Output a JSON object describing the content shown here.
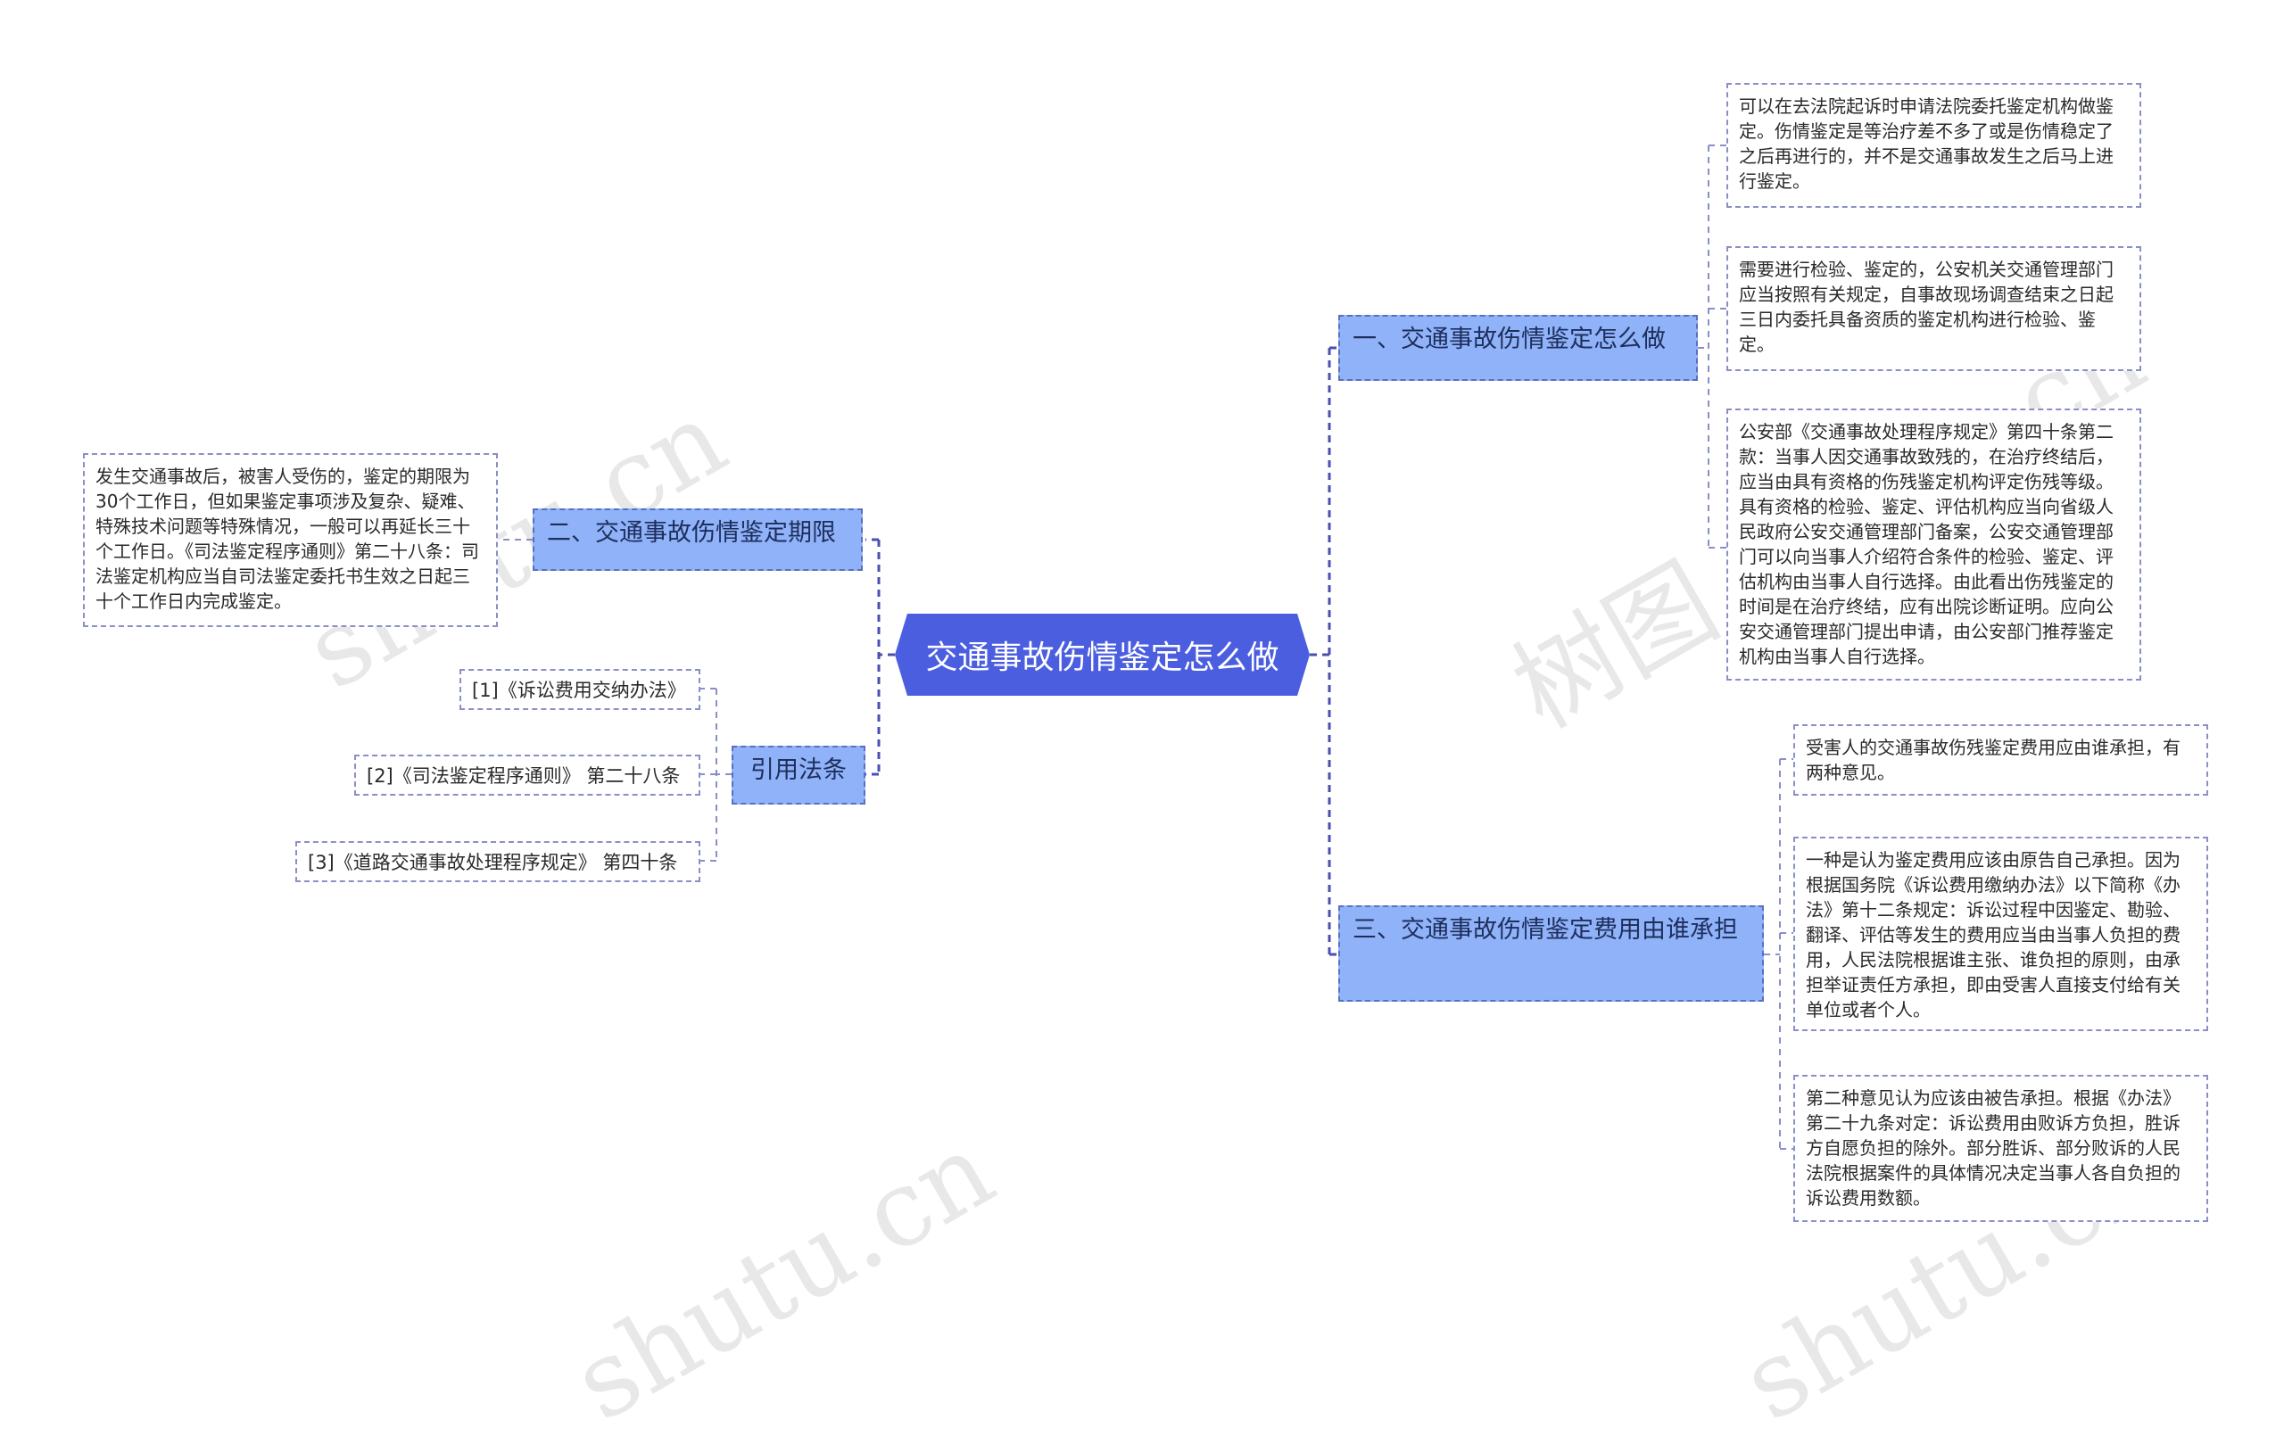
{
  "watermarks": [
    "shutu.cn",
    "树图 shutu.cn",
    "shutu.cn",
    "shutu.cn"
  ],
  "root": {
    "label": "交通事故伤情鉴定怎么做"
  },
  "branches": {
    "b1": {
      "label": "一、交通事故伤情鉴定怎么做",
      "leaves": [
        "可以在去法院起诉时申请法院委托鉴定机构做鉴定。伤情鉴定是等治疗差不多了或是伤情稳定了之后再进行的，并不是交通事故发生之后马上进行鉴定。",
        "需要进行检验、鉴定的，公安机关交通管理部门应当按照有关规定，自事故现场调查结束之日起三日内委托具备资质的鉴定机构进行检验、鉴定。",
        "公安部《交通事故处理程序规定》第四十条第二款：当事人因交通事故致残的，在治疗终结后，应当由具有资格的伤残鉴定机构评定伤残等级。具有资格的检验、鉴定、评估机构应当向省级人民政府公安交通管理部门备案，公安交通管理部门可以向当事人介绍符合条件的检验、鉴定、评估机构由当事人自行选择。由此看出伤残鉴定的时间是在治疗终结，应有出院诊断证明。应向公安交通管理部门提出申请，由公安部门推荐鉴定机构由当事人自行选择。"
      ]
    },
    "b2": {
      "label": "二、交通事故伤情鉴定期限",
      "leaves": [
        "发生交通事故后，被害人受伤的，鉴定的期限为30个工作日，但如果鉴定事项涉及复杂、疑难、特殊技术问题等特殊情况，一般可以再延长三十个工作日。《司法鉴定程序通则》第二十八条：司法鉴定机构应当自司法鉴定委托书生效之日起三十个工作日内完成鉴定。"
      ]
    },
    "b3": {
      "label": "三、交通事故伤情鉴定费用由谁承担",
      "leaves": [
        "受害人的交通事故伤残鉴定费用应由谁承担，有两种意见。",
        "一种是认为鉴定费用应该由原告自己承担。因为根据国务院《诉讼费用缴纳办法》以下简称《办法》第十二条规定：诉讼过程中因鉴定、勘验、翻译、评估等发生的费用应当由当事人负担的费用，人民法院根据谁主张、谁负担的原则，由承担举证责任方承担，即由受害人直接支付给有关单位或者个人。",
        "第二种意见认为应该由被告承担。根据《办法》第二十九条对定：诉讼费用由败诉方负担，胜诉方自愿负担的除外。部分胜诉、部分败诉的人民法院根据案件的具体情况决定当事人各自负担的诉讼费用数额。"
      ]
    },
    "b4": {
      "label": "引用法条",
      "leaves": [
        "[1]《诉讼费用交纳办法》",
        "[2]《司法鉴定程序通则》 第二十八条",
        "[3]《道路交通事故处理程序规定》 第四十条"
      ]
    }
  },
  "colors": {
    "root_fill": "#4b5ee0",
    "branch_fill": "#8fb2f8",
    "connector": "#4a4fb0",
    "leaf_border": "#8a8fc7"
  }
}
